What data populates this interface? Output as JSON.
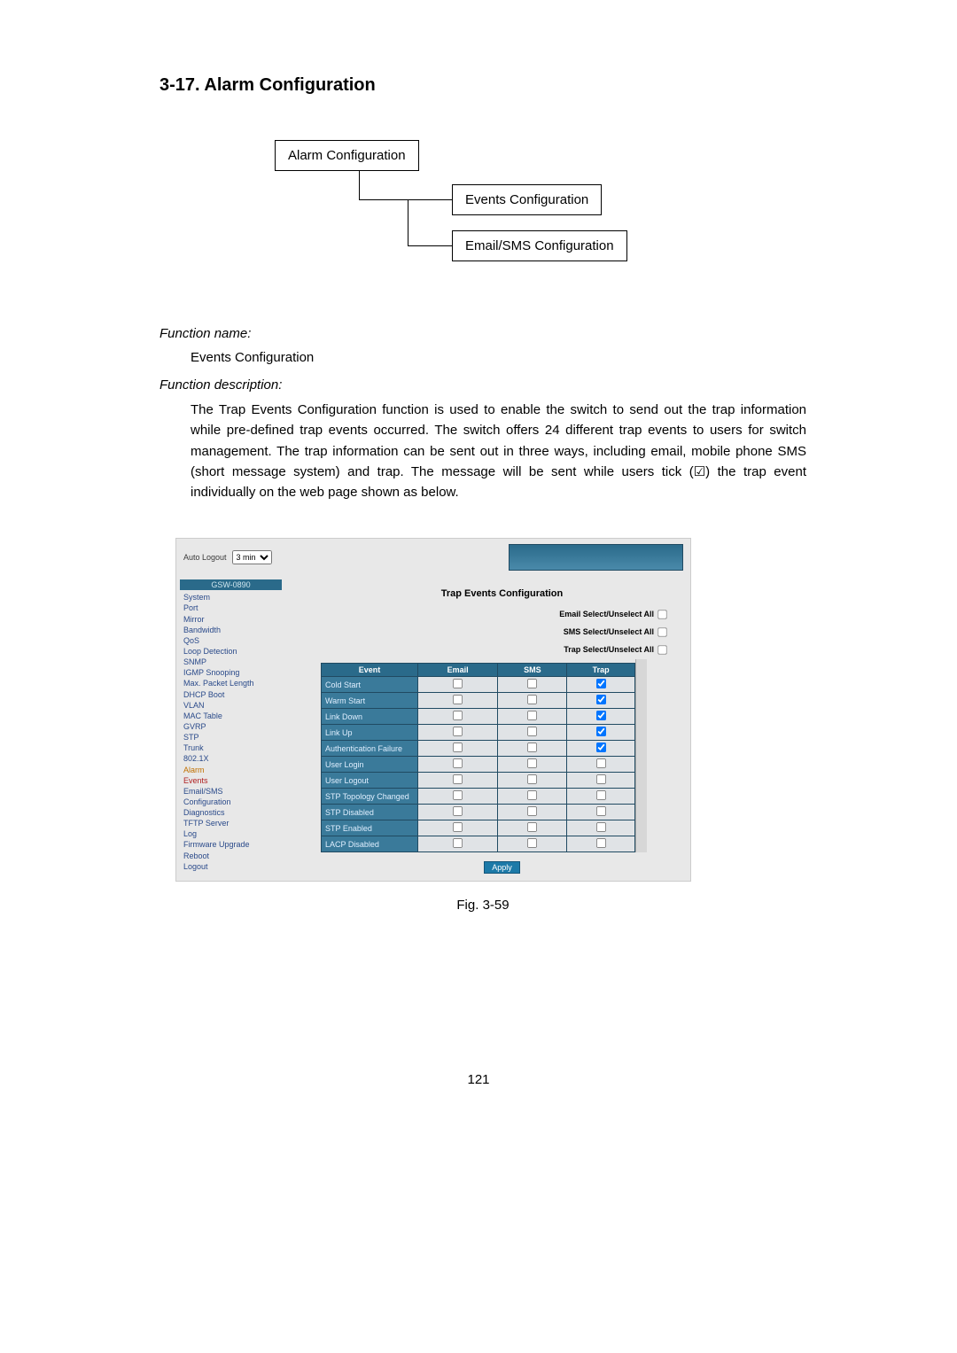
{
  "section_title": "3-17. Alarm Configuration",
  "diagram": {
    "top": "Alarm Configuration",
    "mid": "Events Configuration",
    "bot": "Email/SMS Configuration"
  },
  "labels": {
    "function_name": "Function name:",
    "function_name_value": "Events Configuration",
    "function_desc": "Function description:",
    "body": "The Trap Events Configuration function is used to enable the switch to send out the trap information while pre-defined trap events occurred. The switch offers 24 different trap events to users for switch management. The trap information can be sent out in three ways, including email, mobile phone SMS (short message system) and trap. The message will be sent while users tick (☑) the trap event individually on the web page shown as below."
  },
  "screenshot": {
    "auto_logout_label": "Auto Logout",
    "auto_logout_value": "3 min",
    "device_model": "GSW-0890",
    "nav": [
      {
        "label": "System",
        "cls": ""
      },
      {
        "label": "Port",
        "cls": ""
      },
      {
        "label": "Mirror",
        "cls": ""
      },
      {
        "label": "Bandwidth",
        "cls": ""
      },
      {
        "label": "QoS",
        "cls": ""
      },
      {
        "label": "Loop Detection",
        "cls": ""
      },
      {
        "label": "SNMP",
        "cls": ""
      },
      {
        "label": "IGMP Snooping",
        "cls": ""
      },
      {
        "label": "Max. Packet Length",
        "cls": ""
      },
      {
        "label": "DHCP Boot",
        "cls": ""
      },
      {
        "label": "VLAN",
        "cls": ""
      },
      {
        "label": "MAC Table",
        "cls": ""
      },
      {
        "label": "GVRP",
        "cls": ""
      },
      {
        "label": "STP",
        "cls": ""
      },
      {
        "label": "Trunk",
        "cls": ""
      },
      {
        "label": "802.1X",
        "cls": ""
      },
      {
        "label": "Alarm",
        "cls": "orange"
      },
      {
        "label": "Events",
        "cls": "red"
      },
      {
        "label": "Email/SMS",
        "cls": ""
      },
      {
        "label": "Configuration",
        "cls": ""
      },
      {
        "label": "Diagnostics",
        "cls": ""
      },
      {
        "label": "TFTP Server",
        "cls": ""
      },
      {
        "label": "Log",
        "cls": ""
      },
      {
        "label": "Firmware Upgrade",
        "cls": ""
      },
      {
        "label": "Reboot",
        "cls": ""
      },
      {
        "label": "Logout",
        "cls": ""
      }
    ],
    "main_title": "Trap Events Configuration",
    "select_all": {
      "email": "Email Select/Unselect All",
      "sms": "SMS Select/Unselect All",
      "trap": "Trap Select/Unselect All"
    },
    "table_headers": {
      "event": "Event",
      "email": "Email",
      "sms": "SMS",
      "trap": "Trap"
    },
    "events": [
      {
        "name": "Cold Start",
        "email": false,
        "sms": false,
        "trap": true
      },
      {
        "name": "Warm Start",
        "email": false,
        "sms": false,
        "trap": true
      },
      {
        "name": "Link Down",
        "email": false,
        "sms": false,
        "trap": true
      },
      {
        "name": "Link Up",
        "email": false,
        "sms": false,
        "trap": true
      },
      {
        "name": "Authentication Failure",
        "email": false,
        "sms": false,
        "trap": true
      },
      {
        "name": "User Login",
        "email": false,
        "sms": false,
        "trap": false
      },
      {
        "name": "User Logout",
        "email": false,
        "sms": false,
        "trap": false
      },
      {
        "name": "STP Topology Changed",
        "email": false,
        "sms": false,
        "trap": false
      },
      {
        "name": "STP Disabled",
        "email": false,
        "sms": false,
        "trap": false
      },
      {
        "name": "STP Enabled",
        "email": false,
        "sms": false,
        "trap": false
      },
      {
        "name": "LACP Disabled",
        "email": false,
        "sms": false,
        "trap": false
      }
    ],
    "apply": "Apply"
  },
  "figure_caption": "Fig. 3-59",
  "page_number": "121"
}
